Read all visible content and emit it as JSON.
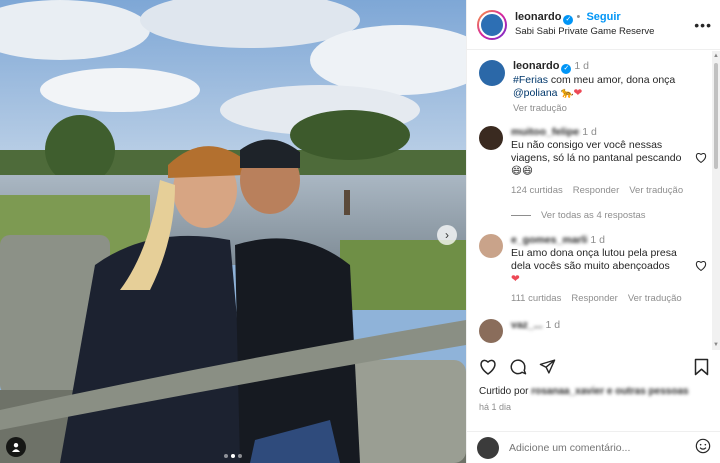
{
  "post": {
    "username": "leonardo",
    "follow_label": "Seguir",
    "location": "Sabi Sabi Private Game Reserve",
    "more_label": "•••"
  },
  "caption": {
    "username": "leonardo",
    "time": "1 d",
    "hashtag": "#Ferias",
    "text": " com meu amor, dona onça ",
    "mention": "@poliana",
    "translate": "Ver tradução"
  },
  "comments": [
    {
      "username": "muitoo_felipe",
      "time": "1 d",
      "text": "Eu não consigo ver você nessas viagens, só lá no pantanal pescando 😄😄",
      "likes": "124 curtidas",
      "reply": "Responder",
      "translate": "Ver tradução",
      "view_replies": "Ver todas as 4 respostas"
    },
    {
      "username": "e_gomes_marli",
      "time": "1 d",
      "text": "Eu amo dona onça lutou pela presa dela vocês são muito abençoados",
      "likes": "111 curtidas",
      "reply": "Responder",
      "translate": "Ver tradução"
    },
    {
      "username": "vaz_...",
      "time": "1 d"
    }
  ],
  "liked_by": {
    "prefix": "Curtido por ",
    "user": "rosanaa_xavier",
    "suffix": " e outras pessoas"
  },
  "post_date": "há 1 dia",
  "add_comment_placeholder": "Adicione um comentário...",
  "icons": {
    "like": "heart-icon",
    "comment": "comment-icon",
    "share": "share-icon",
    "save": "bookmark-icon",
    "emoji": "emoji-icon",
    "next": "chevron-right-icon",
    "tag": "person-tag-icon"
  },
  "colors": {
    "link": "#0095f6",
    "mention": "#00376b",
    "muted": "#8e8e8e",
    "verified": "#0095f6"
  },
  "carousel": {
    "count": 3,
    "active": 1
  }
}
